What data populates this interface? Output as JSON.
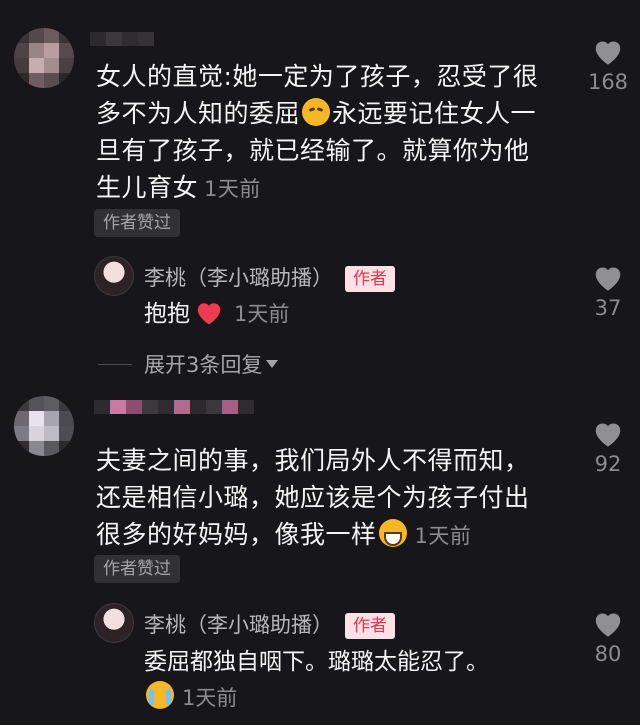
{
  "colors": {
    "background": "#17161a",
    "author_tag_bg": "#fde0e5",
    "author_tag_text": "#e8364f",
    "heart": "#ef3b4f"
  },
  "comments": [
    {
      "lines": [
        "女人的直觉:她一定为了孩子，忍受了很",
        "多不为人知的委屈",
        "永远要记住女人一",
        "旦有了孩子，就已经输了。就算你为他",
        "生儿育女"
      ],
      "emoji": "disappointed-face-icon",
      "time": "1天前",
      "badge": "作者赞过",
      "likes": "168"
    },
    {
      "lines": [
        "夫妻之间的事，我们局外人不得而知，",
        "还是相信小璐，她应该是个为孩子付出",
        "很多的好妈妈，像我一样"
      ],
      "emoji": "grinning-face-icon",
      "time": "1天前",
      "badge": "作者赞过",
      "likes": "92"
    }
  ],
  "replies": [
    {
      "name": "李桃（李小璐助播）",
      "tag": "作者",
      "text": "抱抱",
      "emoji": "red-heart-icon",
      "time": "1天前",
      "likes": "37"
    },
    {
      "name": "李桃（李小璐助播）",
      "tag": "作者",
      "text": "委屈都独自咽下。璐璐太能忍了。",
      "emoji": "crying-face-icon",
      "time": "1天前",
      "likes": "80"
    }
  ],
  "expand_label": "展开3条回复"
}
